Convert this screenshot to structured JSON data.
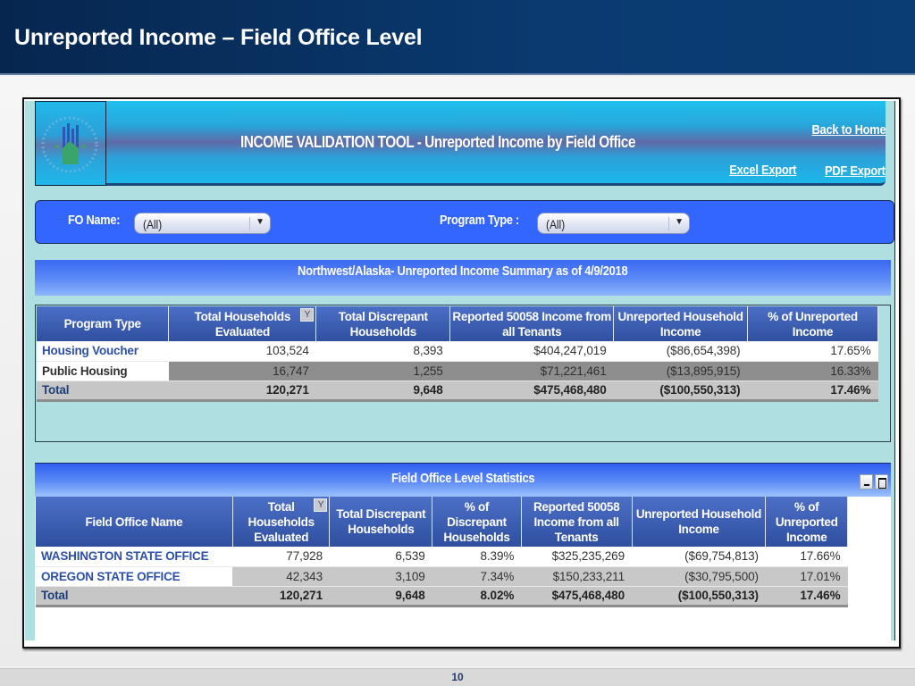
{
  "slide": {
    "title": "Unreported Income – Field Office Level",
    "page_number": "10"
  },
  "app": {
    "banner_title": "INCOME VALIDATION TOOL - Unreported Income by Field Office",
    "logo_icon": "hud-seal-icon",
    "links": {
      "back_home": "Back to Home",
      "excel_export": "Excel Export",
      "pdf_export": "PDF Export"
    },
    "filters": {
      "fo_name_label": "FO Name:",
      "fo_name_value": "(All)",
      "program_type_label": "Program Type :",
      "program_type_value": "(All)"
    },
    "summary": {
      "title": "Northwest/Alaska- Unreported Income Summary as of 4/9/2018",
      "columns": [
        "Program Type",
        "Total Households Evaluated",
        "Total Discrepant Households",
        "Reported 50058 Income from all Tenants",
        "Unreported Household Income",
        "% of Unreported Income"
      ],
      "rows": [
        {
          "program_type": "Housing Voucher",
          "total_households": "103,524",
          "discrepant": "8,393",
          "reported_income": "$404,247,019",
          "unreported_income": "($86,654,398)",
          "pct_unreported": "17.65%"
        },
        {
          "program_type": "Public Housing",
          "total_households": "16,747",
          "discrepant": "1,255",
          "reported_income": "$71,221,461",
          "unreported_income": "($13,895,915)",
          "pct_unreported": "16.33%"
        }
      ],
      "total": {
        "label": "Total",
        "total_households": "120,271",
        "discrepant": "9,648",
        "reported_income": "$475,468,480",
        "unreported_income": "($100,550,313)",
        "pct_unreported": "17.46%"
      }
    },
    "field_office": {
      "title": "Field Office Level Statistics",
      "columns": [
        "Field Office Name",
        "Total Households Evaluated",
        "Total Discrepant Households",
        "% of Discrepant Households",
        "Reported 50058 Income from all Tenants",
        "Unreported Household Income",
        "% of Unreported Income"
      ],
      "rows": [
        {
          "name": "WASHINGTON STATE OFFICE",
          "total_households": "77,928",
          "discrepant": "6,539",
          "pct_discrepant": "8.39%",
          "reported_income": "$325,235,269",
          "unreported_income": "($69,754,813)",
          "pct_unreported": "17.66%"
        },
        {
          "name": "OREGON STATE OFFICE",
          "total_households": "42,343",
          "discrepant": "3,109",
          "pct_discrepant": "7.34%",
          "reported_income": "$150,233,211",
          "unreported_income": "($30,795,500)",
          "pct_unreported": "17.01%"
        }
      ],
      "total": {
        "label": "Total",
        "total_households": "120,271",
        "discrepant": "9,648",
        "pct_discrepant": "8.02%",
        "reported_income": "$475,468,480",
        "unreported_income": "($100,550,313)",
        "pct_unreported": "17.46%"
      }
    },
    "colors": {
      "header_navy": "#0a3a70",
      "banner_cyan": "#1fc0ee",
      "filter_blue": "#3366ff",
      "canvas_teal": "#b0dfe1",
      "table_header_blue": "#2f4f9f",
      "link_blue": "#2c4fa8"
    }
  }
}
